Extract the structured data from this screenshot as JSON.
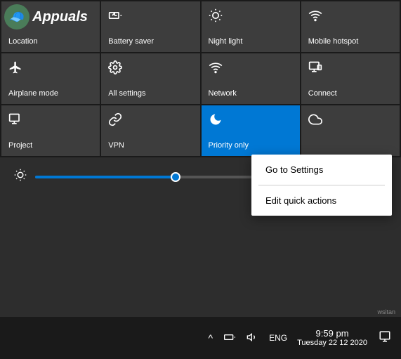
{
  "watermark": {
    "logo": "🧢",
    "text": "Appuals"
  },
  "quickActions": {
    "tiles": [
      {
        "id": "location",
        "label": "Location",
        "icon": "⊞",
        "active": false
      },
      {
        "id": "battery-saver",
        "label": "Battery saver",
        "icon": "🔋",
        "active": false
      },
      {
        "id": "night-light",
        "label": "Night light",
        "icon": "☀",
        "active": false
      },
      {
        "id": "mobile-hotspot",
        "label": "Mobile hotspot",
        "icon": "📶",
        "active": false
      },
      {
        "id": "airplane-mode",
        "label": "Airplane mode",
        "icon": "✈",
        "active": false
      },
      {
        "id": "all-settings",
        "label": "All settings",
        "icon": "⚙",
        "active": false
      },
      {
        "id": "network",
        "label": "Network",
        "icon": "🌐",
        "active": false
      },
      {
        "id": "connect",
        "label": "Connect",
        "icon": "🖥",
        "active": false
      },
      {
        "id": "project",
        "label": "Project",
        "icon": "🖥",
        "active": false
      },
      {
        "id": "vpn",
        "label": "VPN",
        "icon": "∞",
        "active": false
      },
      {
        "id": "priority-only",
        "label": "Priority only",
        "icon": "🌙",
        "active": true
      },
      {
        "id": "cloudy",
        "label": "",
        "icon": "☁",
        "active": false
      }
    ]
  },
  "slider": {
    "icon": "☀",
    "value": 40
  },
  "contextMenu": {
    "items": [
      {
        "id": "go-to-settings",
        "label": "Go to Settings"
      },
      {
        "id": "edit-quick-actions",
        "label": "Edit quick actions"
      }
    ]
  },
  "taskbar": {
    "trayIcons": [
      "^",
      "🔋",
      "🔊",
      "ENG"
    ],
    "time": "9:59 pm",
    "date": "Tuesday 22 12 2020",
    "actionCenterIcon": "□"
  }
}
